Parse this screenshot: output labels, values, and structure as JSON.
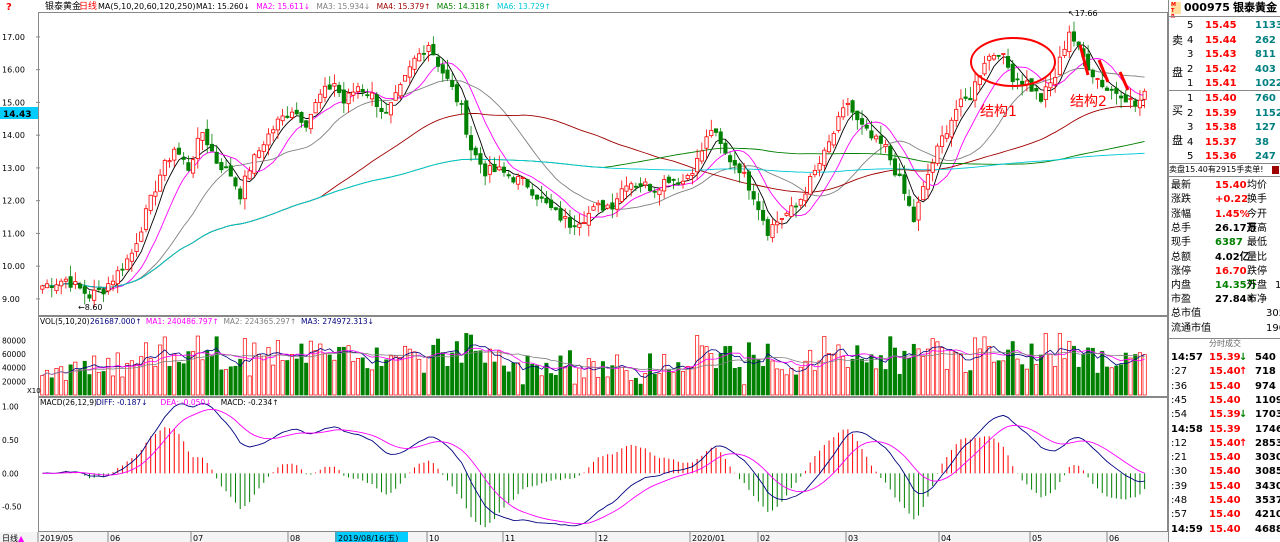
{
  "stock": {
    "code": "000975",
    "name": "银泰黄金",
    "tag": "M\nT\nR"
  },
  "main_chart": {
    "stock_label": "银泰黄金",
    "period_label": "日线",
    "ma_params": "MA(5,10,20,60,120,250)",
    "ma_values": [
      {
        "label": "MA1: 15.260↓",
        "color": "#000000"
      },
      {
        "label": "MA2: 15.611↓",
        "color": "#ff00ff"
      },
      {
        "label": "MA3: 15.934↓",
        "color": "#808080"
      },
      {
        "label": "MA4: 15.379↑",
        "color": "#a00000"
      },
      {
        "label": "MA5: 14.318↑",
        "color": "#008000"
      },
      {
        "label": "MA6: 13.729↑",
        "color": "#00c8d8"
      }
    ],
    "y_ticks": [
      "17.00",
      "16.00",
      "15.00",
      "14.00",
      "13.00",
      "12.00",
      "11.00",
      "10.00",
      "9.00"
    ],
    "y_tick_values": [
      17,
      16,
      15,
      14,
      13,
      12,
      11,
      10,
      9
    ],
    "y_range": [
      8.6,
      17.7
    ],
    "current_price_label": "14.43",
    "current_price": 14.43,
    "high_label": "17.66",
    "high_value": 17.66,
    "low_label": "8.60",
    "low_value": 8.6,
    "annotations": [
      {
        "text": "结构1",
        "color": "#ff0000"
      },
      {
        "text": "结构2",
        "color": "#ff0000"
      }
    ],
    "help_icon": "?"
  },
  "volume_chart": {
    "title": "VOL(5,10,20)",
    "legend": [
      {
        "label": "261687.000↑",
        "color": "#000080"
      },
      {
        "label": "MA1: 240486.797↑",
        "color": "#ff00ff"
      },
      {
        "label": "MA2: 224365.297↑",
        "color": "#808080"
      },
      {
        "label": "MA3: 274972.313↓",
        "color": "#000080"
      }
    ],
    "y_ticks": [
      "80000",
      "60000",
      "40000",
      "20000"
    ],
    "y_tick_values": [
      80000,
      60000,
      40000,
      20000
    ],
    "y_max": 95000,
    "unit": "X10"
  },
  "macd_chart": {
    "title": "MACD(26,12,9)",
    "legend": [
      {
        "label": "DIFF: -0.187↓",
        "color": "#000080"
      },
      {
        "label": "DEA: -0.050↓",
        "color": "#ff00ff"
      },
      {
        "label": "MACD: -0.234↑",
        "color": "#000000"
      }
    ],
    "y_ticks": [
      "1.00",
      "0.50",
      "0.00",
      "-0.50"
    ],
    "y_tick_values": [
      1.0,
      0.5,
      0.0,
      -0.5
    ],
    "y_range": [
      -0.85,
      1.1
    ]
  },
  "x_axis": {
    "period_button": "日线",
    "labels": [
      "2019/05",
      "06",
      "07",
      "08",
      "2019/08/16(五)",
      "10",
      "11",
      "12",
      "2020/01",
      "02",
      "03",
      "04",
      "05",
      "06"
    ],
    "cursor_label": "2019/08/16(五)"
  },
  "order_book": {
    "sell_label": [
      "卖",
      "盘"
    ],
    "buy_label": [
      "买",
      "盘"
    ],
    "sell": [
      {
        "level": "5",
        "price": "15.45",
        "volume": "1133"
      },
      {
        "level": "4",
        "price": "15.44",
        "volume": "262"
      },
      {
        "level": "3",
        "price": "15.43",
        "volume": "811"
      },
      {
        "level": "2",
        "price": "15.42",
        "volume": "403"
      },
      {
        "level": "1",
        "price": "15.41",
        "volume": "1022"
      }
    ],
    "buy": [
      {
        "level": "1",
        "price": "15.40",
        "volume": "760"
      },
      {
        "level": "2",
        "price": "15.39",
        "volume": "1152"
      },
      {
        "level": "3",
        "price": "15.38",
        "volume": "127"
      },
      {
        "level": "4",
        "price": "15.37",
        "volume": "38"
      },
      {
        "level": "5",
        "price": "15.36",
        "volume": "247"
      }
    ],
    "summary": "卖盘15.40有2915手卖单!"
  },
  "quote": {
    "rows": [
      {
        "l1": "最新",
        "v1": "15.40",
        "l2": "均价",
        "c1": "#ff0000"
      },
      {
        "l1": "涨跌",
        "v1": "+0.22",
        "l2": "换手",
        "c1": "#ff0000"
      },
      {
        "l1": "涨幅",
        "v1": "1.45%",
        "l2": "今开",
        "c1": "#ff0000"
      },
      {
        "l1": "总手",
        "v1": "26.17万",
        "l2": "最高",
        "c1": "#000000"
      },
      {
        "l1": "现手",
        "v1": "6387",
        "l2": "最低",
        "c1": "#008000"
      },
      {
        "l1": "总额",
        "v1": "4.02亿",
        "l2": "量比",
        "c1": "#000000"
      },
      {
        "l1": "涨停",
        "v1": "16.70",
        "l2": "跌停",
        "c1": "#ff0000"
      },
      {
        "l1": "内盘",
        "v1": "14.35万",
        "l2": "外盘",
        "c1": "#008000",
        "extra": "11"
      },
      {
        "l1": "市盈",
        "v1": "27.84①",
        "l2": "市净",
        "c1": "#000000"
      }
    ],
    "market_cap": {
      "label": "总市值",
      "value": "305"
    },
    "float_cap": {
      "label": "流通市值",
      "value": "190"
    }
  },
  "ticks": {
    "title": "分时成交",
    "rows": [
      {
        "time": "14:57",
        "price": "15.39",
        "dir": "↓",
        "vol": "540",
        "pc": "#ff0000",
        "dc": "#008000"
      },
      {
        "time": ":27",
        "price": "15.40",
        "dir": "↑",
        "vol": "718",
        "pc": "#ff0000",
        "dc": "#ff0000"
      },
      {
        "time": ":36",
        "price": "15.40",
        "dir": "",
        "vol": "974",
        "pc": "#ff0000",
        "dc": "#ff0000"
      },
      {
        "time": ":45",
        "price": "15.40",
        "dir": "",
        "vol": "1109",
        "pc": "#ff0000",
        "dc": "#ff0000"
      },
      {
        "time": ":54",
        "price": "15.39",
        "dir": "↓",
        "vol": "1703",
        "pc": "#ff0000",
        "dc": "#008000"
      },
      {
        "time": "14:58",
        "price": "15.39",
        "dir": "",
        "vol": "1746",
        "pc": "#ff0000",
        "dc": "#008000"
      },
      {
        "time": ":12",
        "price": "15.40",
        "dir": "↑",
        "vol": "2853",
        "pc": "#ff0000",
        "dc": "#ff0000"
      },
      {
        "time": ":21",
        "price": "15.40",
        "dir": "",
        "vol": "3030",
        "pc": "#ff0000",
        "dc": "#ff0000"
      },
      {
        "time": ":30",
        "price": "15.40",
        "dir": "",
        "vol": "3085",
        "pc": "#ff0000",
        "dc": "#ff0000"
      },
      {
        "time": ":39",
        "price": "15.40",
        "dir": "",
        "vol": "3430",
        "pc": "#ff0000",
        "dc": "#ff0000"
      },
      {
        "time": ":48",
        "price": "15.40",
        "dir": "",
        "vol": "3537",
        "pc": "#ff0000",
        "dc": "#ff0000"
      },
      {
        "time": ":57",
        "price": "15.40",
        "dir": "",
        "vol": "4210",
        "pc": "#ff0000",
        "dc": "#ff0000"
      },
      {
        "time": "14:59",
        "price": "15.40",
        "dir": "",
        "vol": "4688",
        "pc": "#ff0000",
        "dc": "#ff0000"
      }
    ]
  },
  "colors": {
    "up": "#ff0000",
    "down": "#008000",
    "border": "#888888"
  },
  "chart_data": {
    "type": "candlestick",
    "keypoints": [
      [
        0,
        9.4
      ],
      [
        5,
        9.6
      ],
      [
        8,
        9.3
      ],
      [
        10,
        9.1
      ],
      [
        13,
        9.3
      ],
      [
        16,
        9.8
      ],
      [
        19,
        10.4
      ],
      [
        22,
        11.6
      ],
      [
        25,
        12.8
      ],
      [
        28,
        13.6
      ],
      [
        31,
        13.0
      ],
      [
        34,
        14.1
      ],
      [
        37,
        13.2
      ],
      [
        40,
        12.8
      ],
      [
        42,
        12.2
      ],
      [
        44,
        13.0
      ],
      [
        47,
        13.8
      ],
      [
        50,
        14.4
      ],
      [
        53,
        14.8
      ],
      [
        56,
        14.4
      ],
      [
        59,
        15.2
      ],
      [
        62,
        15.6
      ],
      [
        64,
        15.0
      ],
      [
        67,
        15.5
      ],
      [
        70,
        15.2
      ],
      [
        73,
        14.6
      ],
      [
        76,
        15.4
      ],
      [
        79,
        16.3
      ],
      [
        82,
        16.8
      ],
      [
        84,
        16.2
      ],
      [
        87,
        15.4
      ],
      [
        89,
        14.8
      ],
      [
        91,
        13.6
      ],
      [
        94,
        12.9
      ],
      [
        97,
        12.9
      ],
      [
        100,
        12.7
      ],
      [
        103,
        12.5
      ],
      [
        106,
        12.0
      ],
      [
        109,
        11.6
      ],
      [
        112,
        11.3
      ],
      [
        115,
        11.5
      ],
      [
        118,
        11.8
      ],
      [
        121,
        11.9
      ],
      [
        124,
        12.6
      ],
      [
        127,
        12.5
      ],
      [
        130,
        12.4
      ],
      [
        133,
        12.7
      ],
      [
        136,
        12.6
      ],
      [
        139,
        13.2
      ],
      [
        142,
        14.2
      ],
      [
        145,
        13.4
      ],
      [
        148,
        13.0
      ],
      [
        151,
        12.2
      ],
      [
        154,
        11.1
      ],
      [
        157,
        11.5
      ],
      [
        160,
        11.8
      ],
      [
        163,
        12.6
      ],
      [
        166,
        13.4
      ],
      [
        169,
        14.4
      ],
      [
        171,
        15.0
      ],
      [
        173,
        14.4
      ],
      [
        176,
        13.9
      ],
      [
        179,
        13.6
      ],
      [
        182,
        12.6
      ],
      [
        185,
        11.4
      ],
      [
        188,
        12.8
      ],
      [
        191,
        13.9
      ],
      [
        194,
        14.8
      ],
      [
        197,
        15.2
      ],
      [
        200,
        16.3
      ],
      [
        203,
        16.6
      ],
      [
        206,
        15.8
      ],
      [
        209,
        15.6
      ],
      [
        212,
        15.1
      ],
      [
        215,
        15.8
      ],
      [
        218,
        17.2
      ],
      [
        220,
        16.6
      ],
      [
        223,
        15.9
      ],
      [
        226,
        15.4
      ],
      [
        229,
        15.3
      ],
      [
        232,
        14.9
      ],
      [
        234,
        15.2
      ]
    ],
    "n": 235,
    "ma_lines": [
      "MA5",
      "MA10",
      "MA20",
      "MA60",
      "MA120",
      "MA250"
    ],
    "y_range": [
      8.6,
      17.7
    ]
  }
}
